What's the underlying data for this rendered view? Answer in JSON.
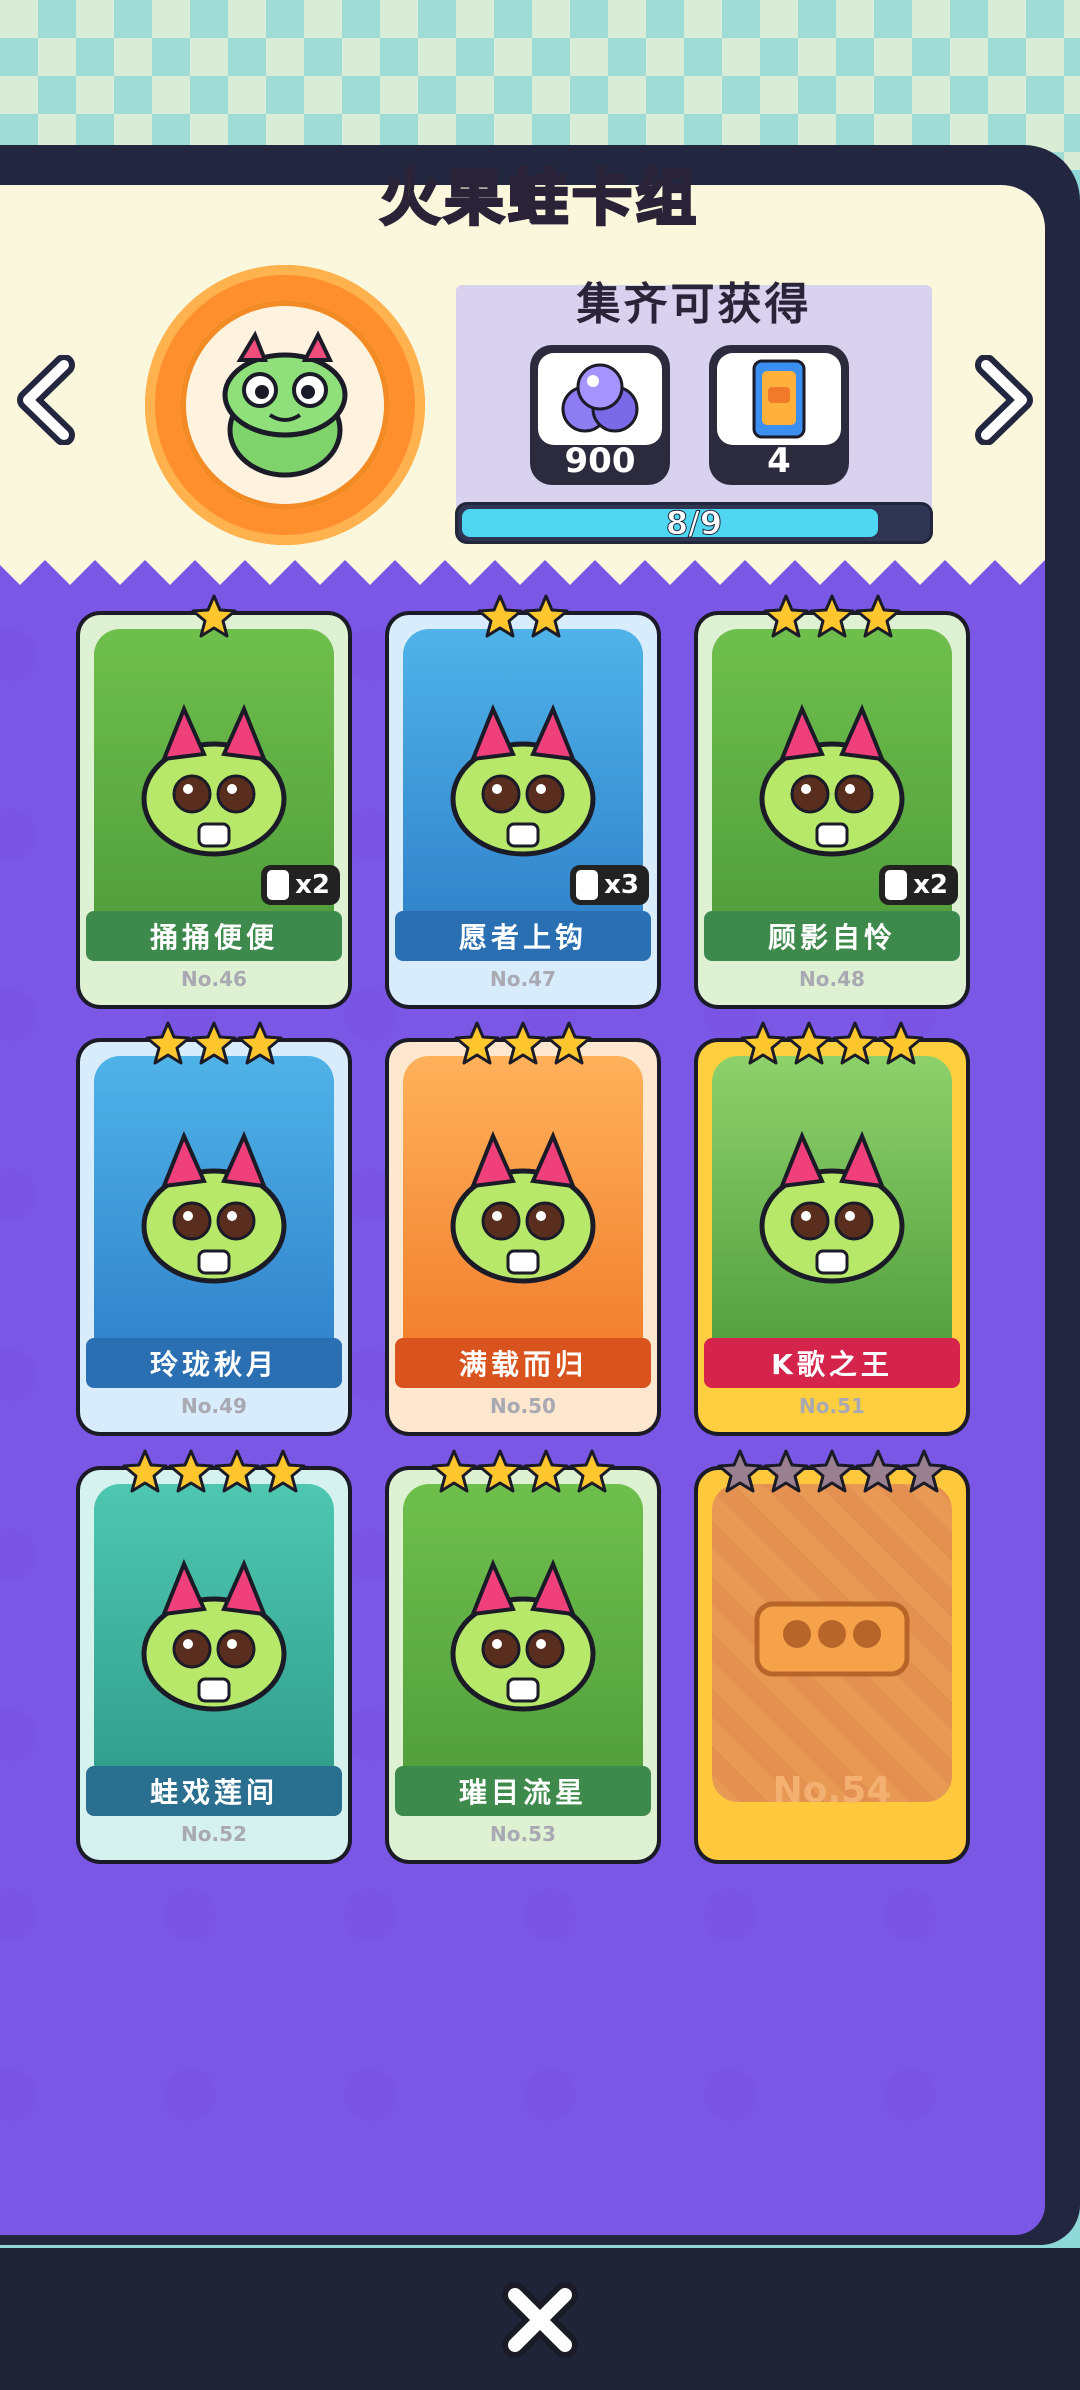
{
  "header": {
    "title": "火果蛙卡组"
  },
  "rewards": {
    "title": "集齐可获得",
    "items": [
      {
        "icon": "orb-cluster-icon",
        "amount": "900"
      },
      {
        "icon": "card-pack-icon",
        "amount": "4"
      }
    ],
    "progress_text": "8/9",
    "progress_value": 0.89
  },
  "nav": {
    "prev": "chevron-left-icon",
    "next": "chevron-right-icon"
  },
  "cards": [
    {
      "name": "捅捅便便",
      "no": "No.46",
      "stars": 1,
      "dup": "x2",
      "theme": "green"
    },
    {
      "name": "愿者上钩",
      "no": "No.47",
      "stars": 2,
      "dup": "x3",
      "theme": "blue"
    },
    {
      "name": "顾影自怜",
      "no": "No.48",
      "stars": 3,
      "dup": "x2",
      "theme": "green"
    },
    {
      "name": "玲珑秋月",
      "no": "No.49",
      "stars": 3,
      "dup": "",
      "theme": "blue"
    },
    {
      "name": "满载而归",
      "no": "No.50",
      "stars": 3,
      "dup": "",
      "theme": "orange"
    },
    {
      "name": "K歌之王",
      "no": "No.51",
      "stars": 4,
      "dup": "",
      "theme": "red"
    },
    {
      "name": "蛙戏莲间",
      "no": "No.52",
      "stars": 4,
      "dup": "",
      "theme": "teal"
    },
    {
      "name": "璀目流星",
      "no": "No.53",
      "stars": 4,
      "dup": "",
      "theme": "green"
    },
    {
      "name": "",
      "no": "No.54",
      "stars": 5,
      "dup": "",
      "theme": "locked"
    }
  ],
  "footer": {
    "close": "close-icon"
  },
  "colors": {
    "panel": "#7b57e6",
    "accent": "#ffd23a",
    "progress": "#4fd6f0"
  }
}
